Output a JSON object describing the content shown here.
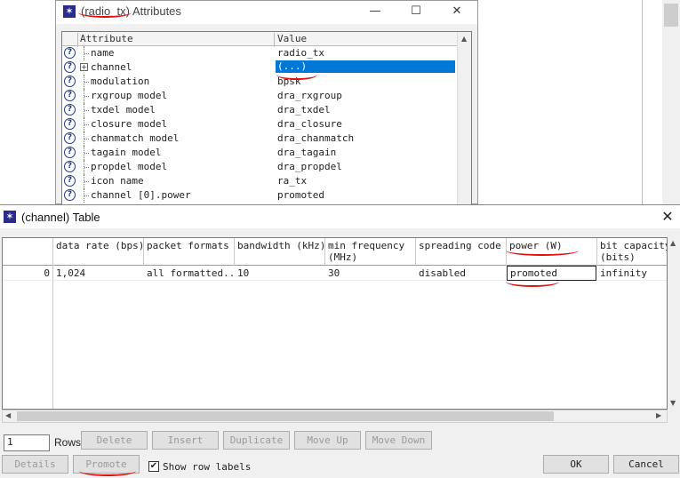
{
  "attributes_window": {
    "title_object": "(radio_tx)",
    "title_suffix": "Attributes",
    "minimize_icon": "minimize-icon",
    "maximize_icon": "maximize-icon",
    "close_icon": "close-icon",
    "columns": [
      "Attribute",
      "Value"
    ],
    "rows": [
      {
        "name": "name",
        "value": "radio_tx"
      },
      {
        "name": "channel",
        "value": "(...)",
        "expandable": true,
        "selected": true
      },
      {
        "name": "modulation",
        "value": "bpsk"
      },
      {
        "name": "rxgroup model",
        "value": "dra_rxgroup"
      },
      {
        "name": "txdel model",
        "value": "dra_txdel"
      },
      {
        "name": "closure model",
        "value": "dra_closure"
      },
      {
        "name": "chanmatch model",
        "value": "dra_chanmatch"
      },
      {
        "name": "tagain model",
        "value": "dra_tagain"
      },
      {
        "name": "propdel model",
        "value": "dra_propdel"
      },
      {
        "name": "icon name",
        "value": "ra_tx"
      },
      {
        "name": "channel [0].power",
        "value": "promoted"
      }
    ]
  },
  "table_dialog": {
    "title": "(channel) Table",
    "close_icon": "close-icon",
    "columns": [
      "data rate (bps)",
      "packet formats",
      "bandwidth (kHz)",
      "min frequency\n(MHz)",
      "spreading code",
      "power (W)",
      "bit capacity\n(bits)"
    ],
    "rows": [
      {
        "label": "0",
        "cells": [
          "1,024",
          "all formatted...",
          "10",
          "30",
          "disabled",
          "promoted",
          "infinity"
        ]
      }
    ],
    "rows_count": "1",
    "rows_label": "Rows",
    "buttons": {
      "delete": "Delete",
      "insert": "Insert",
      "duplicate": "Duplicate",
      "move_up": "Move Up",
      "move_down": "Move Down",
      "details": "Details",
      "promote": "Promote",
      "ok": "OK",
      "cancel": "Cancel"
    },
    "show_row_labels": "Show row labels",
    "show_row_labels_checked": true
  },
  "colors": {
    "selection": "#0078d7",
    "annotation": "#e01010"
  }
}
